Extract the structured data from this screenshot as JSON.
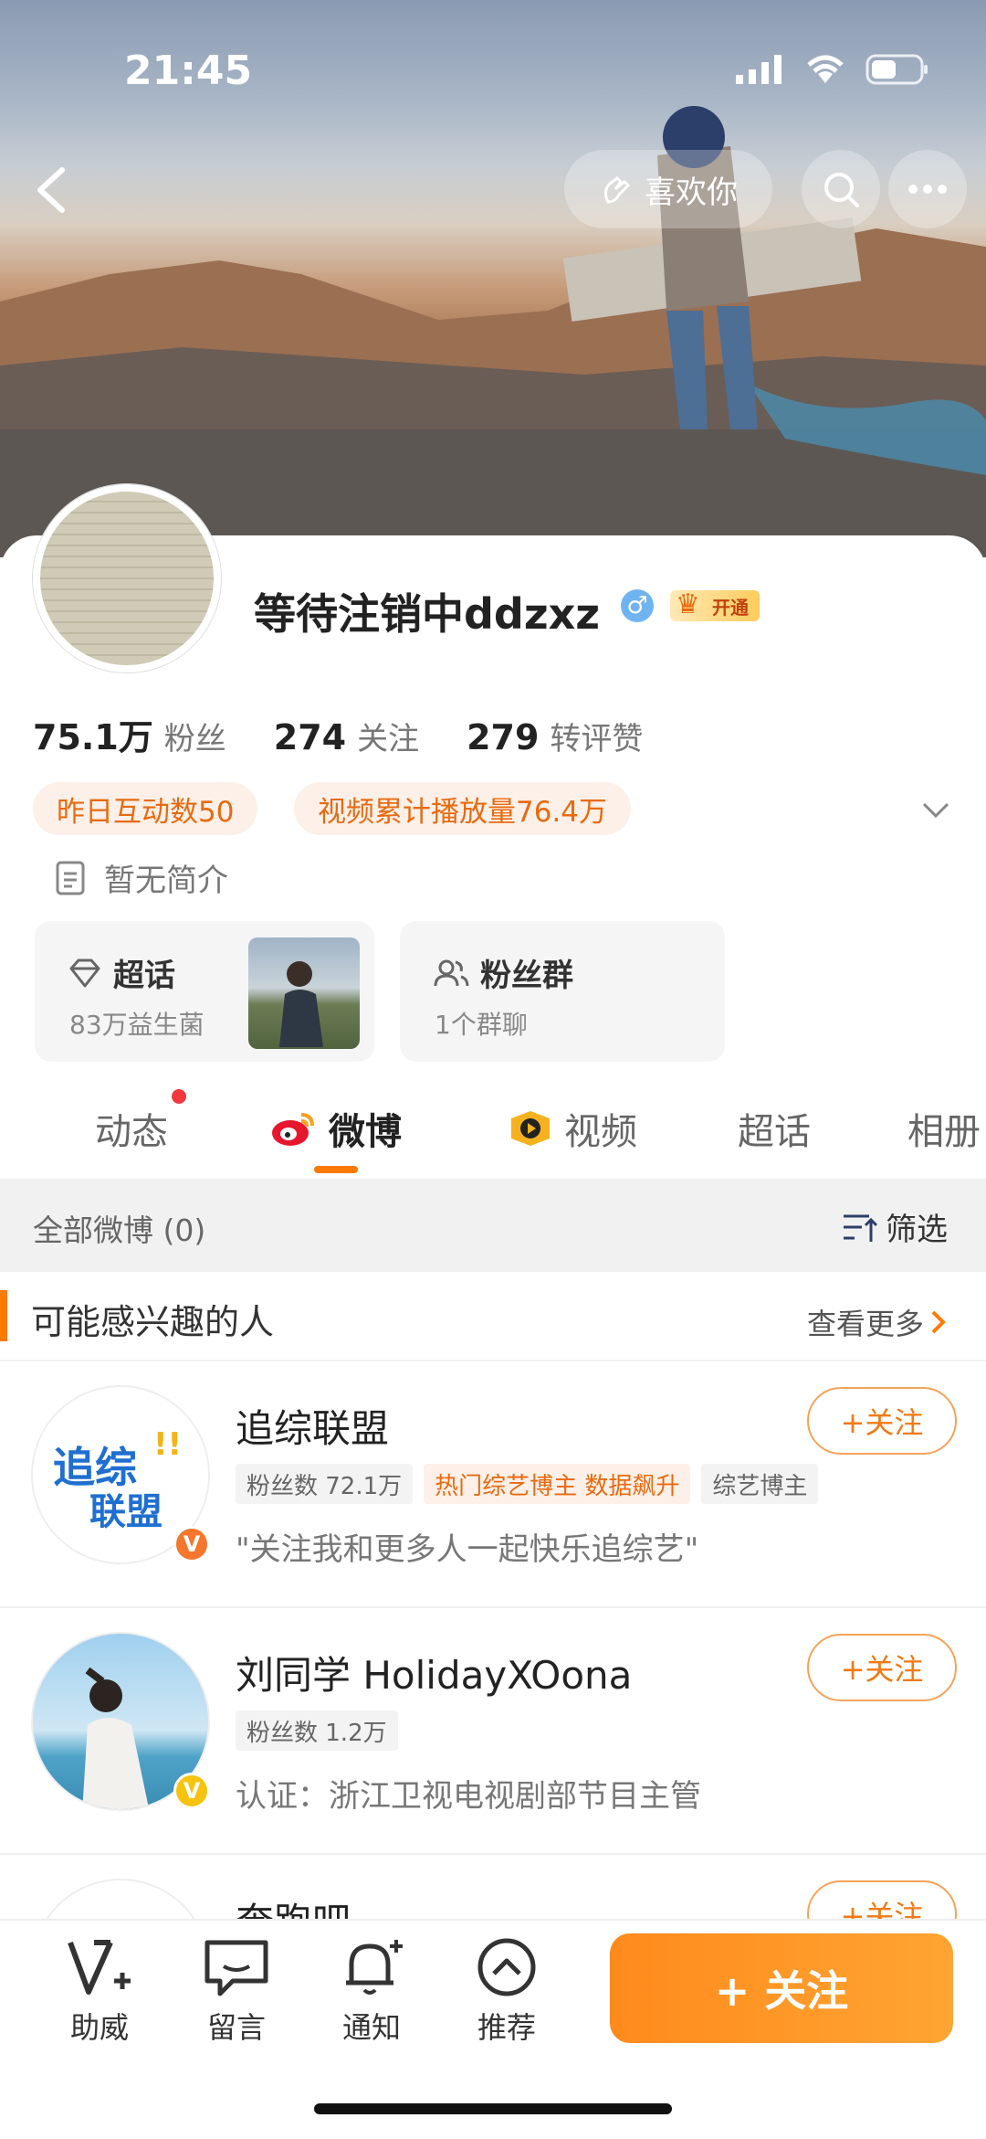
{
  "status_bar": {
    "time": "21:45"
  },
  "header": {
    "like_label": "喜欢你"
  },
  "profile": {
    "username": "等待注销中ddzxz",
    "gender_symbol": "♂",
    "vip_label": "开通",
    "stats": [
      {
        "num": "75.1万",
        "label": "粉丝"
      },
      {
        "num": "274",
        "label": "关注"
      },
      {
        "num": "279",
        "label": "转评赞"
      }
    ],
    "pills": [
      "昨日互动数50",
      "视频累计播放量76.4万"
    ],
    "bio": "暂无简介"
  },
  "tiles": [
    {
      "title": "超话",
      "sub": "83万益生菌",
      "icon": "diamond-icon"
    },
    {
      "title": "粉丝群",
      "sub": "1个群聊",
      "icon": "group-icon"
    }
  ],
  "tabs": [
    "动态",
    "微博",
    "视频",
    "超话",
    "相册"
  ],
  "filter": {
    "left": "全部微博 (0)",
    "right": "筛选"
  },
  "recommend": {
    "title": "可能感兴趣的人",
    "more": "查看更多",
    "people": [
      {
        "name": "追综联盟",
        "tags": [
          "粉丝数 72.1万",
          "热门综艺博主 数据飙升",
          "综艺博主"
        ],
        "desc": "\"关注我和更多人一起快乐追综艺\"",
        "follow": "+关注",
        "badge_color": "#f5762c",
        "avatar_text": "追综联盟"
      },
      {
        "name": "刘同学 HolidayXOona",
        "tags": [
          "粉丝数 1.2万"
        ],
        "desc": "认证：浙江卫视电视剧部节目主管",
        "follow": "+关注",
        "badge_color": "#f6c30e"
      },
      {
        "name": "奔跑吧",
        "follow": "+关注"
      }
    ]
  },
  "bottom_nav": [
    {
      "label": "助威",
      "icon": "cheer-icon"
    },
    {
      "label": "留言",
      "icon": "message-icon"
    },
    {
      "label": "通知",
      "icon": "bell-icon"
    },
    {
      "label": "推荐",
      "icon": "recommend-icon"
    }
  ],
  "big_follow": "+ 关注",
  "colors": {
    "accent": "#ff7a00",
    "pill_bg": "#fdf0e8",
    "pill_text": "#e86a10"
  }
}
